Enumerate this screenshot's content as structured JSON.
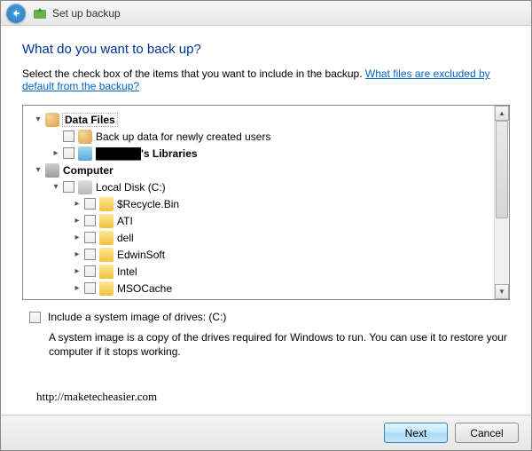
{
  "window": {
    "title": "Set up backup"
  },
  "page": {
    "heading": "What do you want to back up?",
    "instruction": "Select the check box of the items that you want to include in the backup. ",
    "help_link": "What files are excluded by default from the backup?",
    "watermark": "http://maketecheasier.com"
  },
  "tree": {
    "data_files": {
      "label": "Data Files",
      "expanded": true,
      "children": [
        {
          "label": "Back up data for newly created users",
          "checked": false
        },
        {
          "label": "██████'s Libraries",
          "checked": false,
          "expandable": true
        }
      ]
    },
    "computer": {
      "label": "Computer",
      "expanded": true,
      "children": [
        {
          "label": "Local Disk (C:)",
          "checked": false,
          "expanded": true,
          "children": [
            {
              "label": "$Recycle.Bin",
              "checked": false
            },
            {
              "label": "ATI",
              "checked": false
            },
            {
              "label": "dell",
              "checked": false
            },
            {
              "label": "EdwinSoft",
              "checked": false
            },
            {
              "label": "Intel",
              "checked": false
            },
            {
              "label": "MSOCache",
              "checked": false
            }
          ]
        }
      ]
    }
  },
  "options": {
    "system_image_label": "Include a system image of drives: (C:)",
    "system_image_checked": false,
    "system_image_desc": "A system image is a copy of the drives required for Windows to run. You can use it to restore your computer if it stops working."
  },
  "footer": {
    "next": "Next",
    "cancel": "Cancel"
  }
}
